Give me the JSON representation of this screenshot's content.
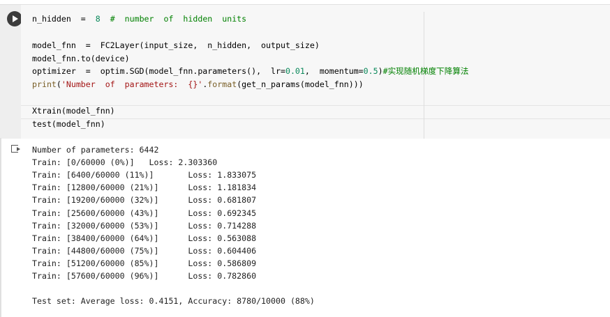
{
  "code_lines": [
    [
      {
        "t": "n_hidden  =  ",
        "c": "k"
      },
      {
        "t": "8",
        "c": "n"
      },
      {
        "t": "  #  number  of  hidden  units",
        "c": "c"
      }
    ],
    [],
    [
      {
        "t": "model_fnn  =  FC2Layer(input_size,  n_hidden,  output_size)",
        "c": "k"
      }
    ],
    [
      {
        "t": "model_fnn.to(device)",
        "c": "k"
      }
    ],
    [
      {
        "t": "optimizer  =  optim.SGD(model_fnn.parameters(),  lr=",
        "c": "k"
      },
      {
        "t": "0.01",
        "c": "n"
      },
      {
        "t": ",  momentum=",
        "c": "k"
      },
      {
        "t": "0.5",
        "c": "n"
      },
      {
        "t": ")",
        "c": "k"
      },
      {
        "t": "#实现随机梯度下降算法",
        "c": "c"
      }
    ],
    [
      {
        "t": "print",
        "c": "f"
      },
      {
        "t": "(",
        "c": "k"
      },
      {
        "t": "'Number  of  parameters:  {}'",
        "c": "s"
      },
      {
        "t": ".",
        "c": "k"
      },
      {
        "t": "format",
        "c": "f"
      },
      {
        "t": "(get_n_params(model_fnn)))",
        "c": "k"
      }
    ],
    [],
    [
      {
        "t": "Xtrain(model_fnn)",
        "c": "k"
      }
    ],
    [
      {
        "t": "test(model_fnn)",
        "c": "k"
      }
    ]
  ],
  "output_lines": [
    "Number of parameters: 6442",
    "Train: [0/60000 (0%)]   Loss: 2.303360",
    "Train: [6400/60000 (11%)]       Loss: 1.833075",
    "Train: [12800/60000 (21%)]      Loss: 1.181834",
    "Train: [19200/60000 (32%)]      Loss: 0.681807",
    "Train: [25600/60000 (43%)]      Loss: 0.692345",
    "Train: [32000/60000 (53%)]      Loss: 0.714288",
    "Train: [38400/60000 (64%)]      Loss: 0.563088",
    "Train: [44800/60000 (75%)]      Loss: 0.604406",
    "Train: [51200/60000 (85%)]      Loss: 0.586809",
    "Train: [57600/60000 (96%)]      Loss: 0.782860",
    "",
    "Test set: Average loss: 0.4151, Accuracy: 8780/10000 (88%)"
  ]
}
